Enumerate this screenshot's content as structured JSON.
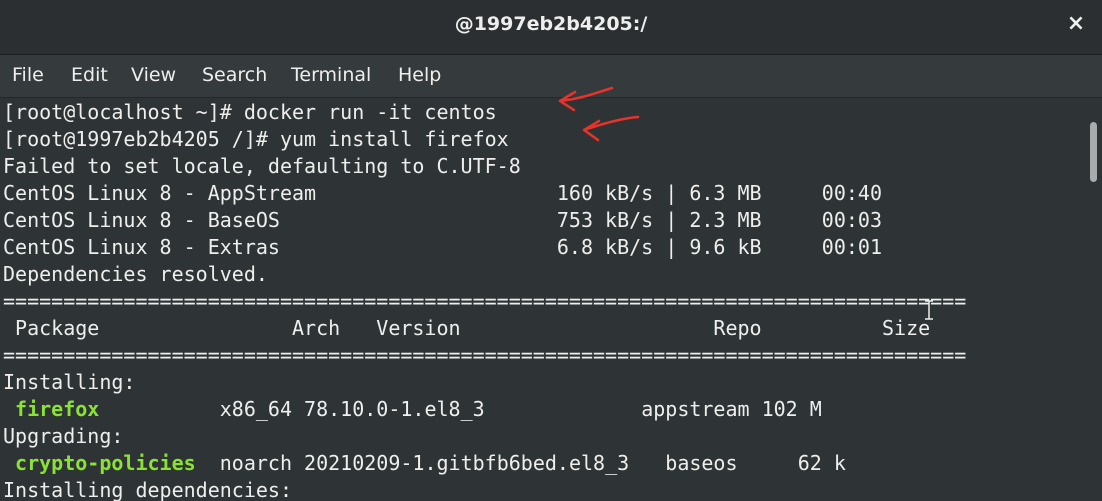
{
  "window": {
    "title": "@1997eb2b4205:/",
    "close_glyph": "×"
  },
  "menubar": [
    "File",
    "Edit",
    "View",
    "Search",
    "Terminal",
    "Help"
  ],
  "terminal": {
    "lines": [
      "[root@localhost ~]# docker run -it centos",
      "[root@1997eb2b4205 /]# yum install firefox",
      "Failed to set locale, defaulting to C.UTF-8",
      "CentOS Linux 8 - AppStream                    160 kB/s | 6.3 MB     00:40",
      "CentOS Linux 8 - BaseOS                       753 kB/s | 2.3 MB     00:03",
      "CentOS Linux 8 - Extras                       6.8 kB/s | 9.6 kB     00:01",
      "Dependencies resolved.",
      "================================================================================",
      " Package                Arch   Version                     Repo          Size",
      "================================================================================",
      "Installing:",
      "",
      "Upgrading:",
      "",
      "Installing dependencies:"
    ],
    "pkg_rows": [
      {
        "name": "firefox",
        "rest": "          x86_64 78.10.0-1.el8_3             appstream 102 M"
      },
      {
        "name": "crypto-policies",
        "rest": "  noarch 20210209-1.gitbfb6bed.el8_3   baseos     62 k"
      }
    ]
  },
  "colors": {
    "annotation": "#e8322a",
    "package_name": "#8ae234"
  }
}
